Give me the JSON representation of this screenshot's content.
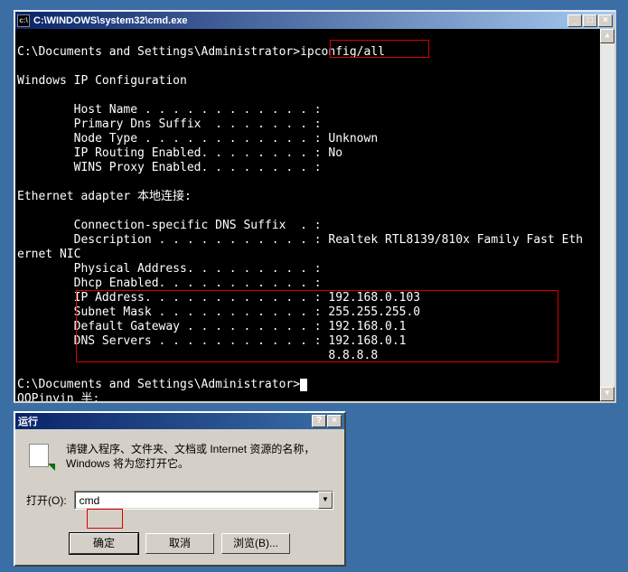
{
  "cmd": {
    "title": "C:\\WINDOWS\\system32\\cmd.exe",
    "titlebar": {
      "min": "_",
      "max": "□",
      "close": "×"
    },
    "scroll": {
      "up": "▲",
      "down": "▼"
    },
    "lines": {
      "l0": "C:\\Documents and Settings\\Administrator>ipconfig/all",
      "l1": "",
      "l2": "Windows IP Configuration",
      "l3": "",
      "l4": "        Host Name . . . . . . . . . . . . :",
      "l5": "        Primary Dns Suffix  . . . . . . . :",
      "l6": "        Node Type . . . . . . . . . . . . : Unknown",
      "l7": "        IP Routing Enabled. . . . . . . . : No",
      "l8": "        WINS Proxy Enabled. . . . . . . . :",
      "l9": "",
      "l10": "Ethernet adapter 本地连接:",
      "l11": "",
      "l12": "        Connection-specific DNS Suffix  . :",
      "l13": "        Description . . . . . . . . . . . : Realtek RTL8139/810x Family Fast Eth",
      "l14": "ernet NIC",
      "l15": "        Physical Address. . . . . . . . . :",
      "l16": "        Dhcp Enabled. . . . . . . . . . . :",
      "l17": "        IP Address. . . . . . . . . . . . : 192.168.0.103",
      "l18": "        Subnet Mask . . . . . . . . . . . : 255.255.255.0",
      "l19": "        Default Gateway . . . . . . . . . : 192.168.0.1",
      "l20": "        DNS Servers . . . . . . . . . . . : 192.168.0.1",
      "l21": "                                            8.8.8.8",
      "l22": "",
      "l23": "C:\\Documents and Settings\\Administrator>",
      "l24": "QQPinyin 半:"
    }
  },
  "run": {
    "title": "运行",
    "help": "?",
    "close": "×",
    "description": "请键入程序、文件夹、文档或 Internet 资源的名称，Windows 将为您打开它。",
    "open_label": "打开(O):",
    "input_value": "cmd",
    "combo_arrow": "▼",
    "buttons": {
      "ok": "确定",
      "cancel": "取消",
      "browse": "浏览(B)..."
    }
  }
}
